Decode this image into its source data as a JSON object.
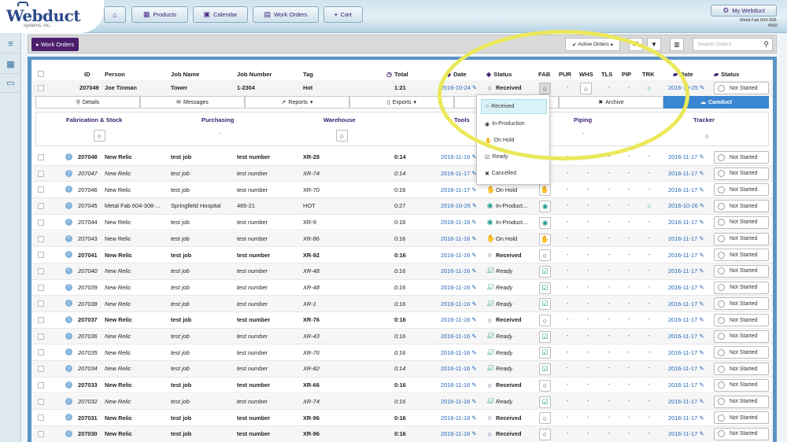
{
  "brand": {
    "name": "Webduct",
    "tagline": "systems, inc."
  },
  "nav": [
    {
      "label": "",
      "icon": "home-icon",
      "glyph": "⌂"
    },
    {
      "label": "Products",
      "icon": "grid-icon",
      "glyph": "▦"
    },
    {
      "label": "Calendar",
      "icon": "calendar-icon",
      "glyph": "▣"
    },
    {
      "label": "Work Orders",
      "icon": "list-icon",
      "glyph": "▤"
    },
    {
      "label": "Cart",
      "icon": "cart-icon",
      "glyph": "🛒"
    }
  ],
  "account": {
    "label": "My Webduct",
    "company_line1": "Metal Fab 604-308-",
    "company_line2": "4560"
  },
  "toolbar": {
    "section_label": "Work Orders",
    "filter_label": "Active Orders",
    "page_size": "25",
    "search_placeholder": "Search Orders"
  },
  "columns": {
    "id": "ID",
    "person": "Person",
    "job_name": "Job Name",
    "job_number": "Job Number",
    "tag": "Tag",
    "total": "Total",
    "date": "Date",
    "status": "Status",
    "fab": "FAB",
    "pur": "PUR",
    "whs": "WHS",
    "tls": "TLS",
    "pip": "PIP",
    "trk": "TRK",
    "date2": "Date",
    "status2": "Status"
  },
  "expanded": {
    "id": "207049",
    "person": "Joe Tinman",
    "job_name": "Tower",
    "job_number": "1-2304",
    "tag": "Hot",
    "total": "1:21",
    "date": "2016-10-24",
    "status": "Received",
    "ship_date": "2016-10-25",
    "ship_status": "Not Started"
  },
  "tabs": {
    "details": "Details",
    "messages": "Messages",
    "reports": "Reports",
    "exports": "Exports",
    "archive": "Archive",
    "camduct": "Camduct"
  },
  "stages": {
    "fabrication": "Fabrication & Stock",
    "purchasing": "Purchasing",
    "warehouse": "Warehouse",
    "tools": "Tools",
    "piping": "Piping",
    "tracker": "Tracker",
    "dash": "-"
  },
  "status_menu": [
    "Received",
    "In-Production",
    "On Hold",
    "Ready",
    "Cancelled"
  ],
  "dash": "-",
  "orders": [
    {
      "id": "207048",
      "person": "New Relic",
      "job": "test job",
      "number": "test number",
      "tag": "XR-28",
      "total": "0:14",
      "date": "2016-11-16",
      "status": "",
      "fab": "",
      "ship": "2016-11-17",
      "ship_status": "Not Started",
      "style": "b"
    },
    {
      "id": "207047",
      "person": "New Relic",
      "job": "test job",
      "number": "test number",
      "tag": "XR-74",
      "total": "0:14",
      "date": "2016-11-17",
      "status": "",
      "fab": "",
      "ship": "2016-11-17",
      "ship_status": "Not Started",
      "style": "i"
    },
    {
      "id": "207046",
      "person": "New Relic",
      "job": "test job",
      "number": "test number",
      "tag": "XR-70",
      "total": "0:16",
      "date": "2016-11-17",
      "status": "On Hold",
      "fab": "hold",
      "ship": "2016-11-17",
      "ship_status": "Not Started",
      "style": "n"
    },
    {
      "id": "207045",
      "person": "Metal Fab 604-308-...",
      "job": "Springfield Hospital",
      "number": "465-21",
      "tag": "HOT",
      "total": "0:27",
      "date": "2016-10-26",
      "status": "In-Product...",
      "fab": "prod",
      "ship": "2016-10-26",
      "ship_status": "Not Started",
      "style": "n"
    },
    {
      "id": "207044",
      "person": "New Relic",
      "job": "test job",
      "number": "test number",
      "tag": "XR-9",
      "total": "0:16",
      "date": "2016-11-16",
      "status": "In-Product...",
      "fab": "prod",
      "ship": "2016-11-17",
      "ship_status": "Not Started",
      "style": "n"
    },
    {
      "id": "207043",
      "person": "New Relic",
      "job": "test job",
      "number": "test number",
      "tag": "XR-86",
      "total": "0:16",
      "date": "2016-11-16",
      "status": "On Hold",
      "fab": "hold",
      "ship": "2016-11-17",
      "ship_status": "Not Started",
      "style": "n"
    },
    {
      "id": "207041",
      "person": "New Relic",
      "job": "test job",
      "number": "test number",
      "tag": "XR-92",
      "total": "0:16",
      "date": "2016-11-16",
      "status": "Received",
      "fab": "recv",
      "ship": "2016-11-17",
      "ship_status": "Not Started",
      "style": "b"
    },
    {
      "id": "207040",
      "person": "New Relic",
      "job": "test job",
      "number": "test number",
      "tag": "XR-48",
      "total": "0:16",
      "date": "2016-11-16",
      "status": "Ready",
      "fab": "ready",
      "ship": "2016-11-17",
      "ship_status": "Not Started",
      "style": "i"
    },
    {
      "id": "207039",
      "person": "New Relic",
      "job": "test job",
      "number": "test number",
      "tag": "XR-48",
      "total": "0:16",
      "date": "2016-11-16",
      "status": "Ready",
      "fab": "ready",
      "ship": "2016-11-17",
      "ship_status": "Not Started",
      "style": "i"
    },
    {
      "id": "207038",
      "person": "New Relic",
      "job": "test job",
      "number": "test number",
      "tag": "XR-1",
      "total": "0:16",
      "date": "2016-11-16",
      "status": "Ready",
      "fab": "ready",
      "ship": "2016-11-17",
      "ship_status": "Not Started",
      "style": "i"
    },
    {
      "id": "207037",
      "person": "New Relic",
      "job": "test job",
      "number": "test number",
      "tag": "XR-76",
      "total": "0:16",
      "date": "2016-11-16",
      "status": "Received",
      "fab": "recv",
      "ship": "2016-11-17",
      "ship_status": "Not Started",
      "style": "b"
    },
    {
      "id": "207036",
      "person": "New Relic",
      "job": "test job",
      "number": "test number",
      "tag": "XR-43",
      "total": "0:16",
      "date": "2016-11-16",
      "status": "Ready",
      "fab": "ready",
      "ship": "2016-11-17",
      "ship_status": "Not Started",
      "style": "i"
    },
    {
      "id": "207035",
      "person": "New Relic",
      "job": "test job",
      "number": "test number",
      "tag": "XR-76",
      "total": "0:16",
      "date": "2016-11-16",
      "status": "Ready",
      "fab": "ready",
      "ship": "2016-11-17",
      "ship_status": "Not Started",
      "style": "i"
    },
    {
      "id": "207034",
      "person": "New Relic",
      "job": "test job",
      "number": "test number",
      "tag": "XR-82",
      "total": "0:14",
      "date": "2016-11-16",
      "status": "Ready",
      "fab": "ready",
      "ship": "2016-11-17",
      "ship_status": "Not Started",
      "style": "i"
    },
    {
      "id": "207033",
      "person": "New Relic",
      "job": "test job",
      "number": "test number",
      "tag": "XR-66",
      "total": "0:16",
      "date": "2016-11-16",
      "status": "Received",
      "fab": "recv",
      "ship": "2016-11-17",
      "ship_status": "Not Started",
      "style": "b"
    },
    {
      "id": "207032",
      "person": "New Relic",
      "job": "test job",
      "number": "test number",
      "tag": "XR-74",
      "total": "0:16",
      "date": "2016-11-16",
      "status": "Ready",
      "fab": "ready",
      "ship": "2016-11-17",
      "ship_status": "Not Started",
      "style": "i"
    },
    {
      "id": "207031",
      "person": "New Relic",
      "job": "test job",
      "number": "test number",
      "tag": "XR-96",
      "total": "0:16",
      "date": "2016-11-16",
      "status": "Received",
      "fab": "recv",
      "ship": "2016-11-17",
      "ship_status": "Not Started",
      "style": "b"
    },
    {
      "id": "207030",
      "person": "New Relic",
      "job": "test job",
      "number": "test number",
      "tag": "XR-96",
      "total": "0:16",
      "date": "2016-11-16",
      "status": "Received",
      "fab": "recv",
      "ship": "2016-11-17",
      "ship_status": "Not Started",
      "style": "b"
    }
  ],
  "colors": {
    "brand": "#2c4a88",
    "accent": "#3a1a6e",
    "link": "#2266bb",
    "frame": "#5a93c6",
    "highlight": "#ebe85a",
    "camduct": "#3a86d0"
  }
}
